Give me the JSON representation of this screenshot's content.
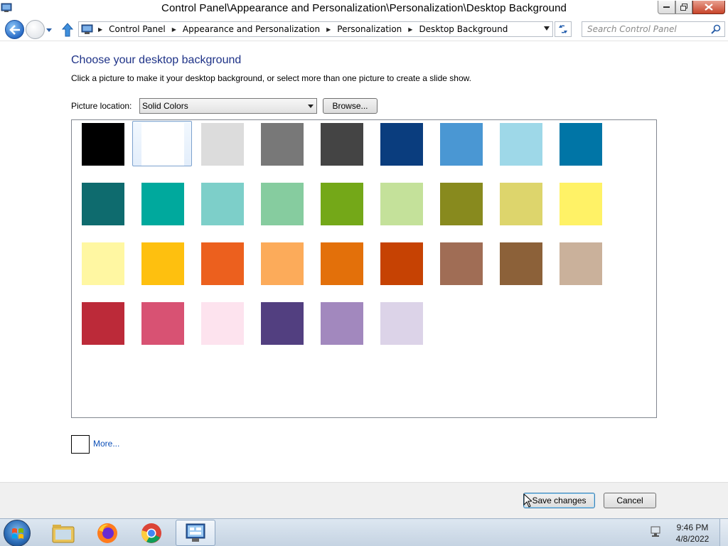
{
  "window": {
    "title": "Control Panel\\Appearance and Personalization\\Personalization\\Desktop Background"
  },
  "address": {
    "crumbs": [
      "Control Panel",
      "Appearance and Personalization",
      "Personalization",
      "Desktop Background"
    ],
    "search_placeholder": "Search Control Panel"
  },
  "page": {
    "heading": "Choose your desktop background",
    "subtext": "Click a picture to make it your desktop background, or select more than one picture to create a slide show.",
    "location_label": "Picture location:",
    "location_value": "Solid Colors",
    "browse_label": "Browse...",
    "more_label": "More...",
    "selected_index": 1,
    "swatches": [
      "#000000",
      "#ffffff",
      "#dcdcdc",
      "#787878",
      "#444444",
      "#0a3d7e",
      "#4a97d3",
      "#9ed8e8",
      "#0075a6",
      "#0e6b6e",
      "#00a99d",
      "#7dcfc9",
      "#86cc9f",
      "#74a818",
      "#c4e19a",
      "#888a1e",
      "#ddd56c",
      "#fff266",
      "#fff7a2",
      "#fec00f",
      "#ec601e",
      "#fcab5a",
      "#e3700a",
      "#c64203",
      "#a06d55",
      "#8c6139",
      "#cab19b",
      "#bc2a39",
      "#d85273",
      "#fde3ee",
      "#523f80",
      "#a288be",
      "#dcd3e8"
    ]
  },
  "footer": {
    "save_label": "Save changes",
    "cancel_label": "Cancel"
  },
  "taskbar": {
    "time": "9:46 PM",
    "date": "4/8/2022",
    "items": [
      "explorer-icon",
      "firefox-icon",
      "chrome-icon",
      "control-panel-icon"
    ]
  }
}
